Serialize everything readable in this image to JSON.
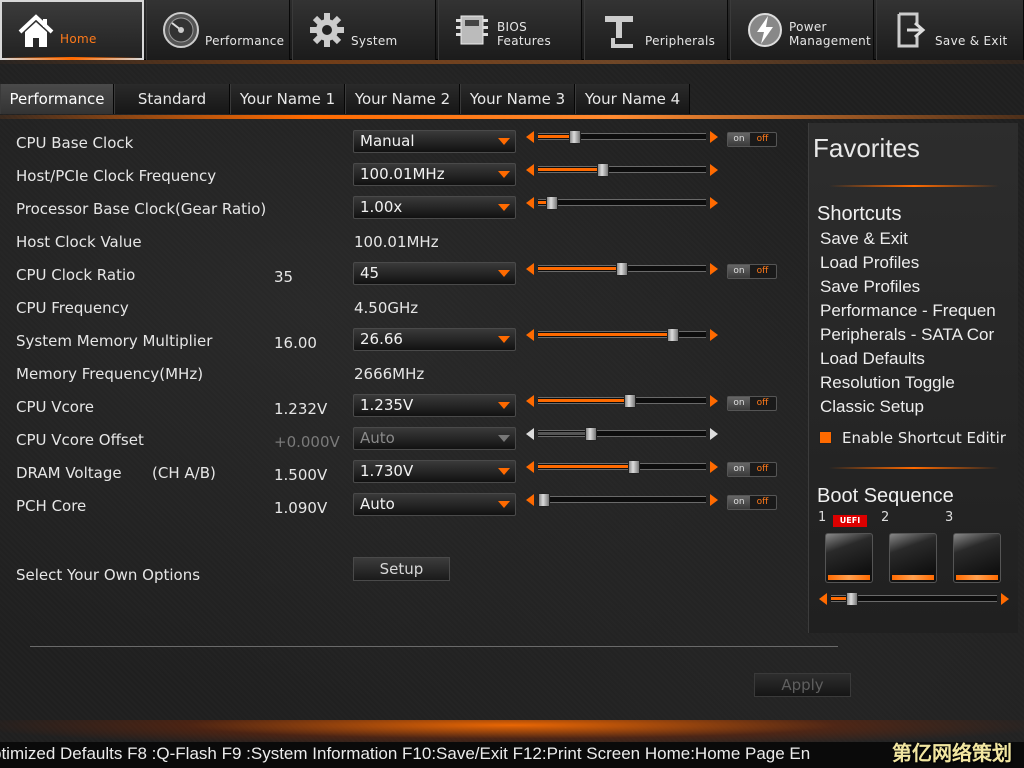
{
  "nav": {
    "tabs": [
      {
        "label": "Home",
        "icon": "home-icon"
      },
      {
        "label": "Performance",
        "icon": "speedometer-icon"
      },
      {
        "label": "System",
        "icon": "gear-icon"
      },
      {
        "label": "BIOS Features",
        "line1": "BIOS",
        "line2": "Features",
        "icon": "bios-chip-icon"
      },
      {
        "label": "Peripherals",
        "icon": "peripherals-icon"
      },
      {
        "label": "Power Management",
        "line1": "Power",
        "line2": "Management",
        "icon": "power-bolt-icon"
      },
      {
        "label": "Save & Exit",
        "icon": "exit-door-icon"
      }
    ],
    "active": "Home"
  },
  "subtabs": [
    "Performance",
    "Standard",
    "Your Name 1",
    "Your Name 2",
    "Your Name 3",
    "Your Name 4"
  ],
  "settings": [
    {
      "name": "CPU Base Clock",
      "control": "Manual",
      "slider": 0.2,
      "toggle": true
    },
    {
      "name": "Host/PCIe Clock Frequency",
      "control": "100.01MHz",
      "slider": 0.38
    },
    {
      "name": "Processor Base Clock(Gear Ratio)",
      "control": "1.00x",
      "slider": 0.05
    },
    {
      "name": "Host Clock Value",
      "value": "100.01MHz"
    },
    {
      "name": "CPU Clock Ratio",
      "current": "35",
      "control": "45",
      "slider": 0.5,
      "toggle": true
    },
    {
      "name": "CPU Frequency",
      "value": "4.50GHz"
    },
    {
      "name": "System Memory Multiplier",
      "current": "16.00",
      "control": "26.66",
      "slider": 0.83
    },
    {
      "name": "Memory Frequency(MHz)",
      "value": "2666MHz"
    },
    {
      "name": "CPU Vcore",
      "current": "1.232V",
      "control": "1.235V",
      "slider": 0.55,
      "toggle": true
    },
    {
      "name": "CPU Vcore Offset",
      "current": "+0.000V",
      "control": "Auto",
      "slider": 0.3,
      "disabled": true
    },
    {
      "name": "DRAM Voltage",
      "sub": "(CH A/B)",
      "current": "1.500V",
      "control": "1.730V",
      "slider": 0.58,
      "toggle": true
    },
    {
      "name": "PCH Core",
      "current": "1.090V",
      "control": "Auto",
      "slider": 0.0,
      "toggle": true
    }
  ],
  "toggle_labels": {
    "on": "on",
    "off": "off"
  },
  "own_options": {
    "label": "Select Your Own Options",
    "button": "Setup"
  },
  "apply_button": "Apply",
  "favorites": {
    "title": "Favorites",
    "shortcuts_title": "Shortcuts",
    "shortcuts": [
      "Save & Exit",
      "Load Profiles",
      "Save Profiles",
      "Performance - Frequen",
      "Peripherals - SATA Cor",
      "Load Defaults",
      "Resolution Toggle",
      "Classic Setup"
    ],
    "enable_editing": "Enable Shortcut Editir",
    "boot_title": "Boot Sequence",
    "boot_numbers": [
      "1",
      "2",
      "3"
    ],
    "uefi_badge": "UEFI",
    "boot_slider": 0.1
  },
  "footer": "ptimized Defaults F8 :Q-Flash F9 :System Information F10:Save/Exit F12:Print Screen Home:Home Page En",
  "watermark": "第亿网络策划",
  "colors": {
    "accent": "#ff6a00",
    "text": "#e6e6e6",
    "background": "#1f1f1f"
  }
}
